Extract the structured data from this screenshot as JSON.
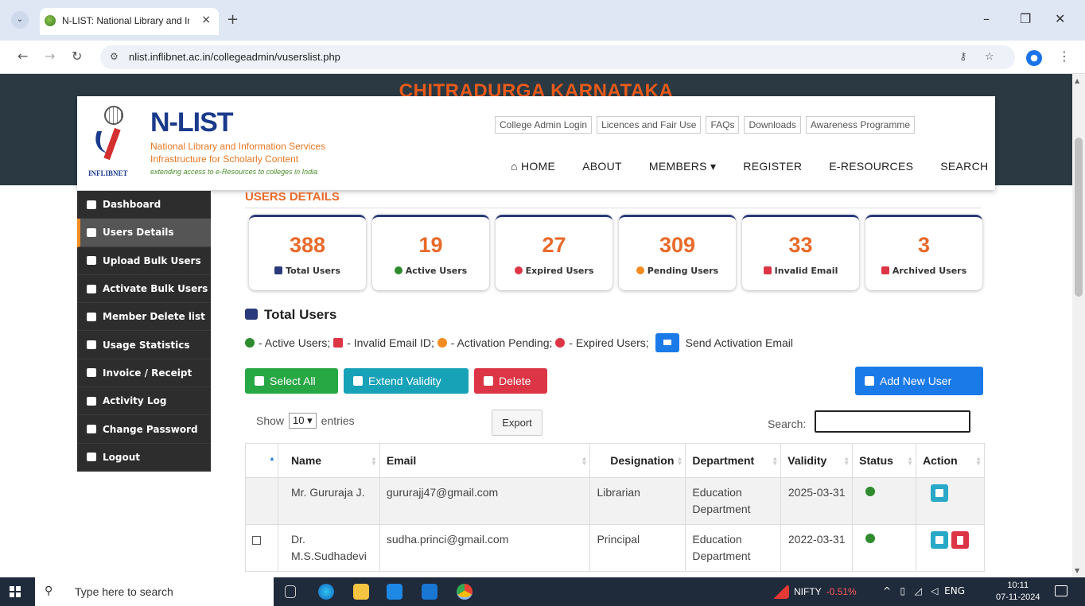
{
  "browser": {
    "tab_title": "N-LIST: National Library and Inf",
    "tab_close": "×",
    "new_tab": "+",
    "url": "nlist.inflibnet.ac.in/collegeadmin/vuserslist.php",
    "minimize": "–",
    "maximize": "❐",
    "close": "✕"
  },
  "hero": {
    "title": "CHITRADURGA  KARNATAKA"
  },
  "header": {
    "logo_title": "N-LIST",
    "logo_line1": "National Library and Information Services",
    "logo_line2": "Infrastructure for Scholarly Content",
    "logo_line3": "extending access to e-Resources to colleges in India",
    "logo_org": "INFLIBNET",
    "top_links": [
      "College Admin Login",
      "Licences and Fair Use",
      "FAQs",
      "Downloads",
      "Awareness Programme"
    ],
    "main_nav": [
      "HOME",
      "ABOUT",
      "MEMBERS ▾",
      "REGISTER",
      "E-RESOURCES",
      "SEARCH"
    ]
  },
  "sidebar": {
    "items": [
      {
        "label": "Dashboard",
        "icon": "dashboard-icon"
      },
      {
        "label": "Users Details",
        "icon": "users-icon"
      },
      {
        "label": "Upload Bulk Users",
        "icon": "upload-users-icon"
      },
      {
        "label": "Activate Bulk Users",
        "icon": "check-icon"
      },
      {
        "label": "Member Delete list",
        "icon": "trash-icon"
      },
      {
        "label": "Usage Statistics",
        "icon": "chart-icon"
      },
      {
        "label": "Invoice / Receipt",
        "icon": "print-icon"
      },
      {
        "label": "Activity Log",
        "icon": "log-icon"
      },
      {
        "label": "Change Password",
        "icon": "key-icon"
      },
      {
        "label": "Logout",
        "icon": "logout-icon"
      }
    ]
  },
  "main": {
    "title": "USERS DETAILS",
    "stats": [
      {
        "value": "388",
        "label": "Total Users",
        "color": "#2a3a7a"
      },
      {
        "value": "19",
        "label": "Active Users",
        "color": "#2e8b2e"
      },
      {
        "value": "27",
        "label": "Expired Users",
        "color": "#dc3545"
      },
      {
        "value": "309",
        "label": "Pending Users",
        "color": "#f28b20"
      },
      {
        "value": "33",
        "label": "Invalid Email",
        "color": "#dc3545"
      },
      {
        "value": "3",
        "label": "Archived Users",
        "color": "#dc3545"
      }
    ],
    "section_title": "Total Users",
    "legend": {
      "active": "- Active Users;",
      "invalid": "- Invalid Email ID;",
      "pending": "- Activation Pending;",
      "expired": "- Expired Users;",
      "send": "Send Activation Email"
    },
    "buttons": {
      "select_all": "Select All",
      "extend_validity": "Extend Validity",
      "delete": "Delete",
      "add_new_user": "Add New User",
      "export": "Export"
    },
    "show_label": "Show",
    "entries_value": "10 ▾",
    "entries_label": "entries",
    "search_label": "Search:",
    "columns": [
      "Name",
      "Email",
      "Designation",
      "Department",
      "Validity",
      "Status",
      "Action"
    ],
    "rows": [
      {
        "name": "Mr. Gururaja J.",
        "email": "gururajj47@gmail.com",
        "designation": "Librarian",
        "department": "Education Department",
        "validity": "2025-03-31"
      },
      {
        "name": "Dr. M.S.Sudhadevi",
        "email": "sudha.princi@gmail.com",
        "designation": "Principal",
        "department": "Education Department",
        "validity": "2022-03-31"
      }
    ]
  },
  "taskbar": {
    "search_placeholder": "Type here to search",
    "nifty_label": "NIFTY",
    "nifty_value": "-0.51%",
    "language": "ENG",
    "time": "10:11",
    "date": "07-11-2024"
  }
}
